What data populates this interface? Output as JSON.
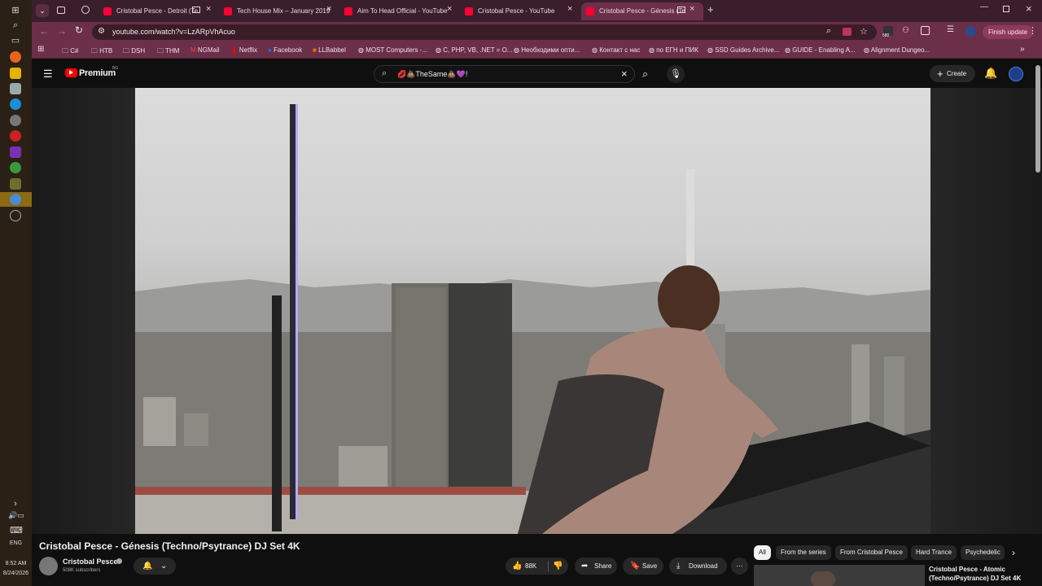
{
  "taskbar": {
    "language": "ENG",
    "time": "8:52 AM",
    "date": "8/24/2026"
  },
  "tabs": [
    {
      "label": "Cristobal Pesce - Detroit (Te",
      "active": false
    },
    {
      "label": "Tech House Mix – January 2019",
      "active": false
    },
    {
      "label": "Aim To Head Official - YouTube",
      "active": false
    },
    {
      "label": "Cristobal Pesce - YouTube",
      "active": false
    },
    {
      "label": "Cristobal Pesce - Génesis (Te",
      "active": true
    }
  ],
  "address": {
    "url": "youtube.com/watch?v=LzARpVhAcuo",
    "extension_badge": "580",
    "finish_update": "Finish update"
  },
  "bookmarks": [
    "C#",
    "HTB",
    "DSH",
    "THM",
    "NGMail",
    "Netflix",
    "Facebook",
    "LLBabbel",
    "MOST Computers -...",
    "C, PHP, VB, .NET = O...",
    "Необходими опти...",
    "Контакт с нас",
    "по ЕГН и ПИК",
    "SSD Guides Archive...",
    "GUIDE - Enabling A...",
    "Alignment Dungeo..."
  ],
  "yt": {
    "logo": "Premium",
    "logo_region": "BG",
    "search_value": "💋💩TheSame💩💜!",
    "create": "Create"
  },
  "video": {
    "title": "Cristobal Pesce - Génesis (Techno/Psytrance) DJ Set 4K",
    "channel": "Cristobal Pesce",
    "subscribers": "508K subscribers",
    "likes": "88K",
    "share": "Share",
    "save": "Save",
    "download": "Download"
  },
  "chips": [
    "All",
    "From the series",
    "From Cristobal Pesce",
    "Hard Trance",
    "Psychedelic"
  ],
  "recommendation": {
    "title_line1": "Cristobal Pesce - Atomic",
    "title_line2": "(Techno/Psytrance) DJ Set 4K"
  },
  "colors": {
    "tab_strip": "#3a1e2c",
    "active_tab": "#6b2f49",
    "yt_red": "#ff0000",
    "yt_bg": "#0f0f0f"
  }
}
